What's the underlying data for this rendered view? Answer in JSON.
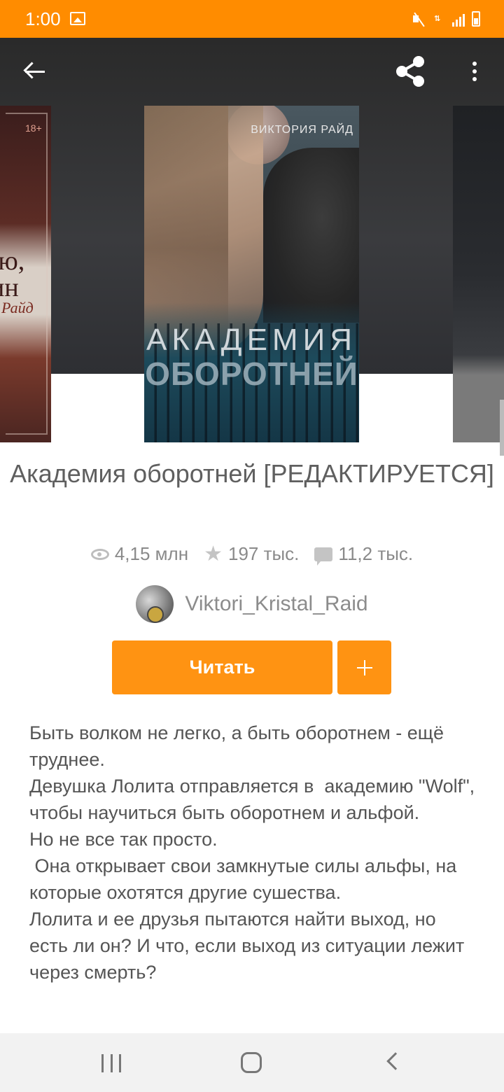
{
  "status_bar": {
    "time": "1:00"
  },
  "covers": {
    "main": {
      "author_text": "ВИКТОРИЯ РАЙД",
      "title_line1": "АКАДЕМИЯ",
      "title_line2": "ОБОРОТНЕЙ"
    },
    "left": {
      "age_badge": "18+",
      "line1": "ью,",
      "line2": "ин",
      "line3": "Райд"
    }
  },
  "book": {
    "title": "Академия оборотней [РЕДАКТИРУЕТСЯ]",
    "stats": {
      "views": "4,15 млн",
      "votes": "197 тыс.",
      "comments": "11,2 тыс."
    },
    "author": "Viktori_Kristal_Raid",
    "read_label": "Читать",
    "add_label": "+",
    "description": [
      "Быть волком не легко, а быть оборотнем - ещё труднее.",
      "Девушка Лолита отправляется в  академию \"Wolf\",  чтобы научиться быть оборотнем и альфой.",
      "Но не все так просто.",
      " Она открывает свои замкнутые силы альфы, на которые охотятся другие сушества.",
      "Лолита и ее друзья пытаются найти выход, но есть ли он? И что, если выход из ситуации лежит через смерть?"
    ]
  },
  "colors": {
    "accent": "#ff9312",
    "status_bar": "#ff8c00"
  }
}
